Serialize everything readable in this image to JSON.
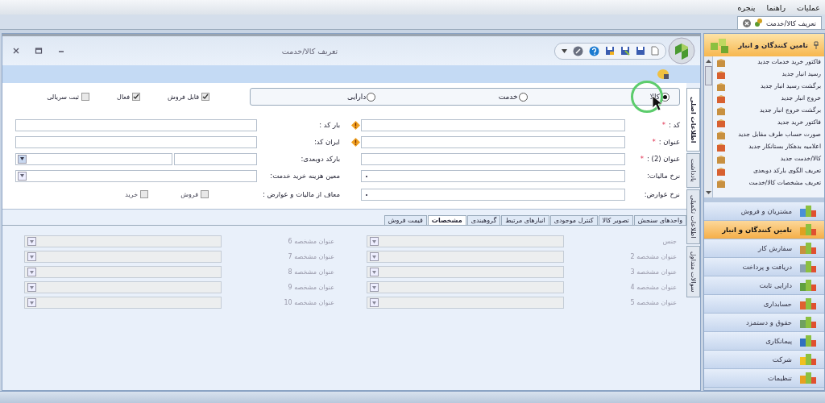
{
  "menu_bar": [
    {
      "label": "عملیات"
    },
    {
      "label": "راهنما"
    },
    {
      "label": "پنجره"
    }
  ],
  "document_tabs": [
    {
      "label": "تعریف کالا/خدمت",
      "selected": true
    }
  ],
  "window": {
    "title": "تعریف کالا/خدمت"
  },
  "item_type": [
    {
      "label": "کالا",
      "selected": true
    },
    {
      "label": "خدمت",
      "selected": false
    },
    {
      "label": "دارایی",
      "selected": false
    }
  ],
  "flags": [
    {
      "label": "قابل فروش",
      "checked": true
    },
    {
      "label": "فعال",
      "checked": true
    },
    {
      "label": "ثبت سریالی",
      "checked": false
    }
  ],
  "fields_right": [
    {
      "label": "کد :",
      "required": "*",
      "kind": "text"
    },
    {
      "label": "عنوان :",
      "required": "*",
      "kind": "text"
    },
    {
      "label": "عنوان (2) :",
      "required": "*",
      "kind": "text"
    },
    {
      "label": "نرخ مالیات:",
      "kind": "select"
    },
    {
      "label": "نرخ عوارض:",
      "kind": "select"
    }
  ],
  "fields_left": [
    {
      "label": "بار کد :",
      "kind": "text",
      "warning": true
    },
    {
      "label": "ایران کد:",
      "kind": "text",
      "warning": true
    },
    {
      "label": "بارکد دوبعدی:",
      "kind": "split",
      "warning": false
    },
    {
      "label": "معین هزینه خرید خدمت:",
      "kind": "select",
      "warning": false
    },
    {
      "label": "معاف از مالیات و عوارض :",
      "kind": "checks",
      "warning": false,
      "options": [
        {
          "label": "فروش",
          "checked": false
        },
        {
          "label": "خرید",
          "checked": false
        }
      ]
    }
  ],
  "side_tabs": [
    {
      "label": "اطلاعات اصلی",
      "selected": true
    },
    {
      "label": "یادداشت",
      "selected": false
    },
    {
      "label": "اطلاعات تکمیلی",
      "selected": false
    },
    {
      "label": "سوالات متداول",
      "selected": false
    }
  ],
  "detail_tabs": [
    {
      "label": "واحدهای سنجش",
      "selected": false
    },
    {
      "label": "تصویر کالا",
      "selected": false
    },
    {
      "label": "کنترل موجودی",
      "selected": false
    },
    {
      "label": "انبارهای مرتبط",
      "selected": false
    },
    {
      "label": "گروهبندی",
      "selected": false
    },
    {
      "label": "مشخصات",
      "selected": true
    },
    {
      "label": "قیمت فروش",
      "selected": false
    }
  ],
  "specs": [
    {
      "label": "جنس",
      "disabled": true
    },
    {
      "label": "عنوان مشخصه 2",
      "disabled": true
    },
    {
      "label": "عنوان مشخصه 3",
      "disabled": true
    },
    {
      "label": "عنوان مشخصه 4",
      "disabled": true
    },
    {
      "label": "عنوان مشخصه 5",
      "disabled": true
    },
    {
      "label": "عنوان مشخصه 6",
      "disabled": true
    },
    {
      "label": "عنوان مشخصه 7",
      "disabled": true
    },
    {
      "label": "عنوان مشخصه 8",
      "disabled": true
    },
    {
      "label": "عنوان مشخصه 9",
      "disabled": true
    },
    {
      "label": "عنوان مشخصه 10",
      "disabled": true
    }
  ],
  "sidebar": {
    "title": "تامین کنندگان و انبار",
    "items": [
      {
        "label": "فاکتور خرید خدمات جدید"
      },
      {
        "label": "رسید انبار جدید"
      },
      {
        "label": "برگشت رسید انبار جدید"
      },
      {
        "label": "خروج انبار جدید"
      },
      {
        "label": "برگشت خروج انبار جدید"
      },
      {
        "label": "فاکتور خرید جدید"
      },
      {
        "label": "صورت حساب طرف مقابل جدید"
      },
      {
        "label": "اعلامیه بدهکار بستانکار جدید"
      },
      {
        "label": "کالا/خدمت جدید"
      },
      {
        "label": "تعریف الگوی بارکد دوبعدی"
      },
      {
        "label": "تعریف مشخصات کالا/خدمت"
      }
    ],
    "nav": [
      {
        "label": "مشتریان و فروش",
        "selected": false
      },
      {
        "label": "تامین کنندگان و انبار",
        "selected": true
      },
      {
        "label": "سفارش کار",
        "selected": false
      },
      {
        "label": "دریافت و پرداخت",
        "selected": false
      },
      {
        "label": "دارایی ثابت",
        "selected": false
      },
      {
        "label": "حسابداری",
        "selected": false
      },
      {
        "label": "حقوق و دستمزد",
        "selected": false
      },
      {
        "label": "پیمانکاری",
        "selected": false
      },
      {
        "label": "شرکت",
        "selected": false
      },
      {
        "label": "تنظیمات",
        "selected": false
      }
    ]
  }
}
